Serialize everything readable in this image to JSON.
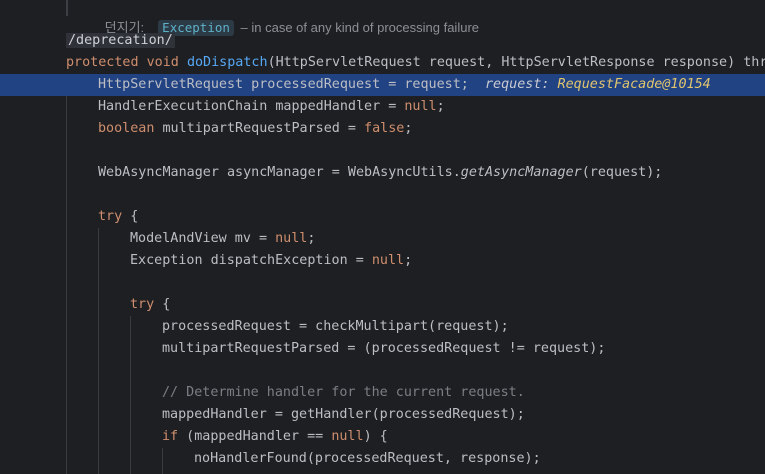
{
  "doc": {
    "label": "던지기:",
    "exception_chip": "Exception",
    "description": "– in case of any kind of processing failure"
  },
  "annotation": "/deprecation/",
  "method": {
    "kw": "protected void ",
    "name": "doDispatch",
    "params": "(HttpServletRequest request, HttpServletResponse response) thro"
  },
  "lines": {
    "l1_type": "HttpServletRequest processedRequest = request;",
    "l1_hint_label": "request: ",
    "l1_hint_value": "RequestFacade@10154",
    "l2_a": "HandlerExecutionChain mappedHandler = ",
    "l2_null": "null",
    "l2_end": ";",
    "l3_kw": "boolean",
    "l3_mid": " multipartRequestParsed = ",
    "l3_false": "false",
    "l3_end": ";",
    "l4_a": "WebAsyncManager asyncManager = WebAsyncUtils.",
    "l4_fn": "getAsyncManager",
    "l4_end": "(request);",
    "l5_try": "try",
    "l5_brace": " {",
    "l6_a": "ModelAndView mv = ",
    "l6_null": "null",
    "l6_end": ";",
    "l7_a": "Exception dispatchException = ",
    "l7_null": "null",
    "l7_end": ";",
    "l8_try": "try",
    "l8_brace": " {",
    "l9": "processedRequest = checkMultipart(request);",
    "l10": "multipartRequestParsed = (processedRequest != request);",
    "l11_comment": "// Determine handler for the current request.",
    "l12": "mappedHandler = getHandler(processedRequest);",
    "l13_if": "if",
    "l13_a": " (mappedHandler == ",
    "l13_null": "null",
    "l13_end": ") {",
    "l14": "noHandlerFound(processedRequest, response);"
  }
}
